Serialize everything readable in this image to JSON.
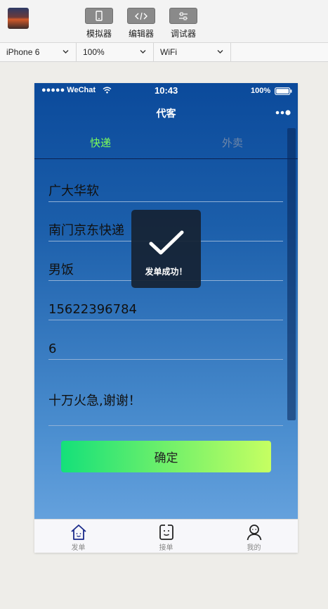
{
  "toolbar": {
    "simulator_label": "模拟器",
    "editor_label": "编辑器",
    "debugger_label": "调试器"
  },
  "selectors": {
    "device": "iPhone 6",
    "zoom": "100%",
    "network": "WiFi"
  },
  "status_bar": {
    "carrier": "●●●●● WeChat",
    "time": "10:43",
    "battery": "100%"
  },
  "nav": {
    "title": "代客"
  },
  "tabs": [
    {
      "label": "快递",
      "active": true,
      "color": "#7cff5a"
    },
    {
      "label": "外卖",
      "active": false,
      "color": "#6e86a8"
    }
  ],
  "form": {
    "field1": "广大华软",
    "field2": "南门京东快递",
    "field3": "男饭",
    "field4": "15622396784",
    "field5": "6",
    "note": "十万火急,谢谢！",
    "confirm_label": "确定"
  },
  "toast": {
    "message": "发单成功！",
    "icon": "checkmark-icon"
  },
  "bottom_nav": [
    {
      "label": "发单",
      "icon": "house-icon"
    },
    {
      "label": "接单",
      "icon": "clipboard-face-icon"
    },
    {
      "label": "我的",
      "icon": "person-icon"
    }
  ]
}
